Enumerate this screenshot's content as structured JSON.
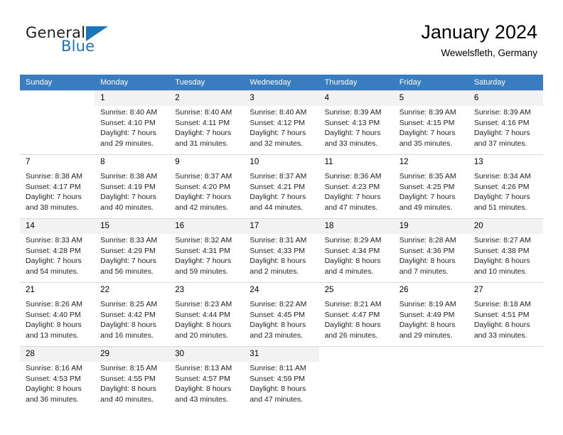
{
  "brand": {
    "name_part1": "General",
    "name_part2": "Blue",
    "accent_color": "#1b75bb"
  },
  "header": {
    "title": "January 2024",
    "location": "Wewelsfleth, Germany"
  },
  "calendar": {
    "header_bg": "#3a7cc0",
    "weekday_headers": [
      "Sunday",
      "Monday",
      "Tuesday",
      "Wednesday",
      "Thursday",
      "Friday",
      "Saturday"
    ],
    "weeks": [
      [
        {
          "day": "",
          "sunrise": "",
          "sunset": "",
          "daylight1": "",
          "daylight2": ""
        },
        {
          "day": "1",
          "sunrise": "Sunrise: 8:40 AM",
          "sunset": "Sunset: 4:10 PM",
          "daylight1": "Daylight: 7 hours",
          "daylight2": "and 29 minutes."
        },
        {
          "day": "2",
          "sunrise": "Sunrise: 8:40 AM",
          "sunset": "Sunset: 4:11 PM",
          "daylight1": "Daylight: 7 hours",
          "daylight2": "and 31 minutes."
        },
        {
          "day": "3",
          "sunrise": "Sunrise: 8:40 AM",
          "sunset": "Sunset: 4:12 PM",
          "daylight1": "Daylight: 7 hours",
          "daylight2": "and 32 minutes."
        },
        {
          "day": "4",
          "sunrise": "Sunrise: 8:39 AM",
          "sunset": "Sunset: 4:13 PM",
          "daylight1": "Daylight: 7 hours",
          "daylight2": "and 33 minutes."
        },
        {
          "day": "5",
          "sunrise": "Sunrise: 8:39 AM",
          "sunset": "Sunset: 4:15 PM",
          "daylight1": "Daylight: 7 hours",
          "daylight2": "and 35 minutes."
        },
        {
          "day": "6",
          "sunrise": "Sunrise: 8:39 AM",
          "sunset": "Sunset: 4:16 PM",
          "daylight1": "Daylight: 7 hours",
          "daylight2": "and 37 minutes."
        }
      ],
      [
        {
          "day": "7",
          "sunrise": "Sunrise: 8:38 AM",
          "sunset": "Sunset: 4:17 PM",
          "daylight1": "Daylight: 7 hours",
          "daylight2": "and 38 minutes."
        },
        {
          "day": "8",
          "sunrise": "Sunrise: 8:38 AM",
          "sunset": "Sunset: 4:19 PM",
          "daylight1": "Daylight: 7 hours",
          "daylight2": "and 40 minutes."
        },
        {
          "day": "9",
          "sunrise": "Sunrise: 8:37 AM",
          "sunset": "Sunset: 4:20 PM",
          "daylight1": "Daylight: 7 hours",
          "daylight2": "and 42 minutes."
        },
        {
          "day": "10",
          "sunrise": "Sunrise: 8:37 AM",
          "sunset": "Sunset: 4:21 PM",
          "daylight1": "Daylight: 7 hours",
          "daylight2": "and 44 minutes."
        },
        {
          "day": "11",
          "sunrise": "Sunrise: 8:36 AM",
          "sunset": "Sunset: 4:23 PM",
          "daylight1": "Daylight: 7 hours",
          "daylight2": "and 47 minutes."
        },
        {
          "day": "12",
          "sunrise": "Sunrise: 8:35 AM",
          "sunset": "Sunset: 4:25 PM",
          "daylight1": "Daylight: 7 hours",
          "daylight2": "and 49 minutes."
        },
        {
          "day": "13",
          "sunrise": "Sunrise: 8:34 AM",
          "sunset": "Sunset: 4:26 PM",
          "daylight1": "Daylight: 7 hours",
          "daylight2": "and 51 minutes."
        }
      ],
      [
        {
          "day": "14",
          "sunrise": "Sunrise: 8:33 AM",
          "sunset": "Sunset: 4:28 PM",
          "daylight1": "Daylight: 7 hours",
          "daylight2": "and 54 minutes."
        },
        {
          "day": "15",
          "sunrise": "Sunrise: 8:33 AM",
          "sunset": "Sunset: 4:29 PM",
          "daylight1": "Daylight: 7 hours",
          "daylight2": "and 56 minutes."
        },
        {
          "day": "16",
          "sunrise": "Sunrise: 8:32 AM",
          "sunset": "Sunset: 4:31 PM",
          "daylight1": "Daylight: 7 hours",
          "daylight2": "and 59 minutes."
        },
        {
          "day": "17",
          "sunrise": "Sunrise: 8:31 AM",
          "sunset": "Sunset: 4:33 PM",
          "daylight1": "Daylight: 8 hours",
          "daylight2": "and 2 minutes."
        },
        {
          "day": "18",
          "sunrise": "Sunrise: 8:29 AM",
          "sunset": "Sunset: 4:34 PM",
          "daylight1": "Daylight: 8 hours",
          "daylight2": "and 4 minutes."
        },
        {
          "day": "19",
          "sunrise": "Sunrise: 8:28 AM",
          "sunset": "Sunset: 4:36 PM",
          "daylight1": "Daylight: 8 hours",
          "daylight2": "and 7 minutes."
        },
        {
          "day": "20",
          "sunrise": "Sunrise: 8:27 AM",
          "sunset": "Sunset: 4:38 PM",
          "daylight1": "Daylight: 8 hours",
          "daylight2": "and 10 minutes."
        }
      ],
      [
        {
          "day": "21",
          "sunrise": "Sunrise: 8:26 AM",
          "sunset": "Sunset: 4:40 PM",
          "daylight1": "Daylight: 8 hours",
          "daylight2": "and 13 minutes."
        },
        {
          "day": "22",
          "sunrise": "Sunrise: 8:25 AM",
          "sunset": "Sunset: 4:42 PM",
          "daylight1": "Daylight: 8 hours",
          "daylight2": "and 16 minutes."
        },
        {
          "day": "23",
          "sunrise": "Sunrise: 8:23 AM",
          "sunset": "Sunset: 4:44 PM",
          "daylight1": "Daylight: 8 hours",
          "daylight2": "and 20 minutes."
        },
        {
          "day": "24",
          "sunrise": "Sunrise: 8:22 AM",
          "sunset": "Sunset: 4:45 PM",
          "daylight1": "Daylight: 8 hours",
          "daylight2": "and 23 minutes."
        },
        {
          "day": "25",
          "sunrise": "Sunrise: 8:21 AM",
          "sunset": "Sunset: 4:47 PM",
          "daylight1": "Daylight: 8 hours",
          "daylight2": "and 26 minutes."
        },
        {
          "day": "26",
          "sunrise": "Sunrise: 8:19 AM",
          "sunset": "Sunset: 4:49 PM",
          "daylight1": "Daylight: 8 hours",
          "daylight2": "and 29 minutes."
        },
        {
          "day": "27",
          "sunrise": "Sunrise: 8:18 AM",
          "sunset": "Sunset: 4:51 PM",
          "daylight1": "Daylight: 8 hours",
          "daylight2": "and 33 minutes."
        }
      ],
      [
        {
          "day": "28",
          "sunrise": "Sunrise: 8:16 AM",
          "sunset": "Sunset: 4:53 PM",
          "daylight1": "Daylight: 8 hours",
          "daylight2": "and 36 minutes."
        },
        {
          "day": "29",
          "sunrise": "Sunrise: 8:15 AM",
          "sunset": "Sunset: 4:55 PM",
          "daylight1": "Daylight: 8 hours",
          "daylight2": "and 40 minutes."
        },
        {
          "day": "30",
          "sunrise": "Sunrise: 8:13 AM",
          "sunset": "Sunset: 4:57 PM",
          "daylight1": "Daylight: 8 hours",
          "daylight2": "and 43 minutes."
        },
        {
          "day": "31",
          "sunrise": "Sunrise: 8:11 AM",
          "sunset": "Sunset: 4:59 PM",
          "daylight1": "Daylight: 8 hours",
          "daylight2": "and 47 minutes."
        },
        {
          "day": "",
          "sunrise": "",
          "sunset": "",
          "daylight1": "",
          "daylight2": ""
        },
        {
          "day": "",
          "sunrise": "",
          "sunset": "",
          "daylight1": "",
          "daylight2": ""
        },
        {
          "day": "",
          "sunrise": "",
          "sunset": "",
          "daylight1": "",
          "daylight2": ""
        }
      ]
    ]
  }
}
